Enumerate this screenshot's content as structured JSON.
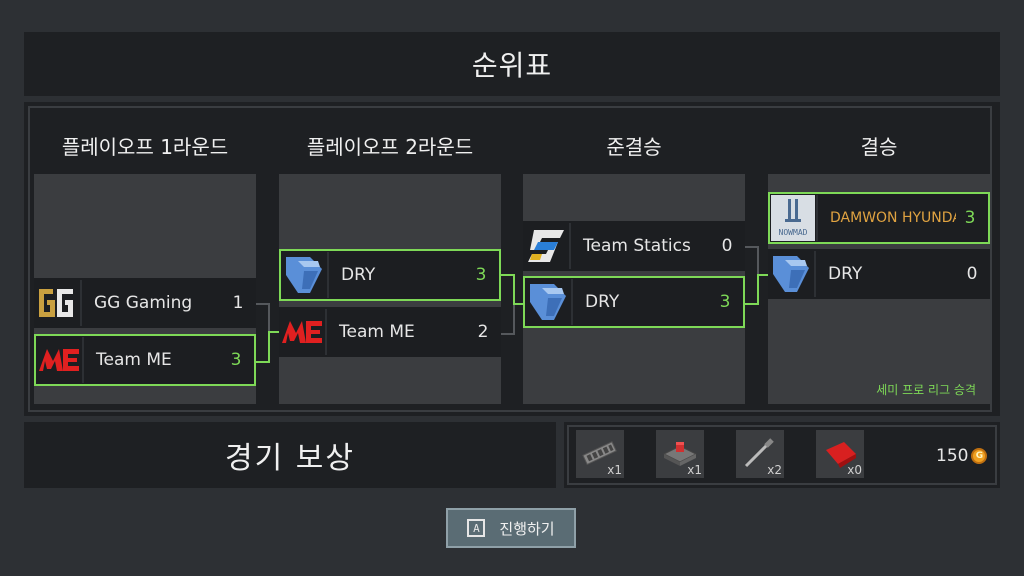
{
  "title": "순위표",
  "rounds": [
    {
      "label": "플레이오프 1라운드",
      "teams": [
        {
          "name": "GG Gaming",
          "score": "1",
          "winner": false,
          "logo": "gg-gaming-logo"
        },
        {
          "name": "Team ME",
          "score": "3",
          "winner": true,
          "logo": "team-me-logo"
        }
      ]
    },
    {
      "label": "플레이오프 2라운드",
      "teams": [
        {
          "name": "DRY",
          "score": "3",
          "winner": true,
          "logo": "dry-logo"
        },
        {
          "name": "Team ME",
          "score": "2",
          "winner": false,
          "logo": "team-me-logo"
        }
      ]
    },
    {
      "label": "준결승",
      "teams": [
        {
          "name": "Team Statics",
          "score": "0",
          "winner": false,
          "logo": "team-statics-logo"
        },
        {
          "name": "DRY",
          "score": "3",
          "winner": true,
          "logo": "dry-logo"
        }
      ]
    },
    {
      "label": "결승",
      "teams": [
        {
          "name": "DAMWON HYUNDAI",
          "score": "3",
          "winner": true,
          "logo": "damwon-logo"
        },
        {
          "name": "DRY",
          "score": "0",
          "winner": false,
          "logo": "dry-logo"
        }
      ]
    }
  ],
  "promotion_note": "세미 프로 리그 승격",
  "reward": {
    "title": "경기 보상",
    "items": [
      {
        "icon": "ram-chip-icon",
        "qty": "x1"
      },
      {
        "icon": "cpu-cooler-icon",
        "qty": "x1"
      },
      {
        "icon": "screwdriver-icon",
        "qty": "x2"
      },
      {
        "icon": "red-cloth-icon",
        "qty": "x0"
      }
    ],
    "coins": "150"
  },
  "proceed": {
    "key": "A",
    "label": "진행하기"
  },
  "colors": {
    "win": "#7ed957",
    "gold": "#e0a341",
    "panel": "#1e2023",
    "column": "#3b3d40"
  }
}
